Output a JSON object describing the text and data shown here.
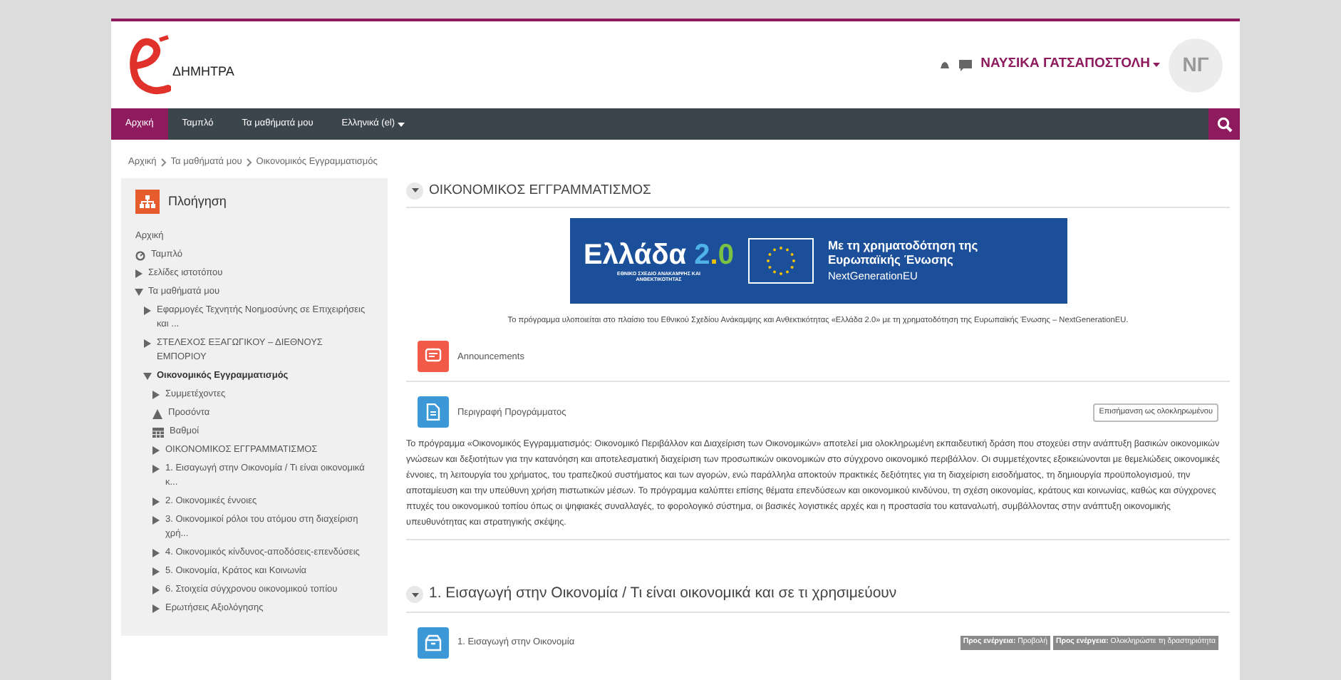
{
  "header": {
    "logo_text": "ΔΗΜΗΤΡΑ",
    "user_name": "ΝΑΥΣΙΚΑ ΓΑΤΣΑΠΟΣΤΟΛΗ",
    "avatar_initials": "ΝΓ"
  },
  "nav": [
    {
      "label": "Αρχική",
      "selected": true,
      "dropdown": false
    },
    {
      "label": "Ταμπλό",
      "selected": false,
      "dropdown": false
    },
    {
      "label": "Τα μαθήματά μου",
      "selected": false,
      "dropdown": false
    },
    {
      "label": "Ελληνικά (el)",
      "selected": false,
      "dropdown": true
    }
  ],
  "breadcrumb": [
    "Αρχική",
    "Τα μαθήματά μου",
    "Οικονομικός Εγγραμματισμός"
  ],
  "sidebar": {
    "title": "Πλοήγηση",
    "items": [
      {
        "label": "Αρχική",
        "kind": "plain",
        "active": false
      },
      {
        "label": "Ταμπλό",
        "kind": "dashboard",
        "active": false
      },
      {
        "label": "Σελίδες ιστοτόπου",
        "kind": "branch",
        "expanded": false,
        "active": false
      },
      {
        "label": "Τα μαθήματά μου",
        "kind": "branch",
        "expanded": true,
        "active": false,
        "children": [
          {
            "label": "Εφαρμογές Τεχνητής Νοημοσύνης σε Επιχειρήσεις και ...",
            "kind": "branch",
            "expanded": false,
            "active": false
          },
          {
            "label": "ΣΤΕΛΕΧΟΣ ΕΞΑΓΩΓΙΚΟΥ – ΔΙΕΘΝΟΥΣ ΕΜΠΟΡΙΟΥ",
            "kind": "branch",
            "expanded": false,
            "active": false
          },
          {
            "label": "Οικονομικός Εγγραμματισμός",
            "kind": "branch",
            "expanded": true,
            "active": true,
            "children": [
              {
                "label": "Συμμετέχοντες",
                "kind": "branch",
                "expanded": false,
                "active": false
              },
              {
                "label": "Προσόντα",
                "kind": "badge",
                "active": false
              },
              {
                "label": "Βαθμοί",
                "kind": "grades",
                "active": false
              },
              {
                "label": "ΟΙΚΟΝΟΜΙΚΟΣ ΕΓΓΡΑΜΜΑΤΙΣΜΟΣ",
                "kind": "branch",
                "expanded": false,
                "active": false
              },
              {
                "label": "1. Εισαγωγή στην Οικονομία / Τι είναι οικονομικά κ...",
                "kind": "branch",
                "expanded": false,
                "active": false
              },
              {
                "label": "2. Οικονομικές έννοιες",
                "kind": "branch",
                "expanded": false,
                "active": false
              },
              {
                "label": "3. Οικονομικοί ρόλοι του ατόμου στη διαχείριση χρή...",
                "kind": "branch",
                "expanded": false,
                "active": false
              },
              {
                "label": "4. Οικονομικός κίνδυνος-αποδόσεις-επενδύσεις",
                "kind": "branch",
                "expanded": false,
                "active": false
              },
              {
                "label": "5. Οικονομία, Κράτος και Κοινωνία",
                "kind": "branch",
                "expanded": false,
                "active": false
              },
              {
                "label": "6. Στοιχεία σύγχρονου οικονομικού τοπίου",
                "kind": "branch",
                "expanded": false,
                "active": false
              },
              {
                "label": "Ερωτήσεις Αξιολόγησης",
                "kind": "branch",
                "expanded": false,
                "active": false
              }
            ]
          }
        ]
      }
    ]
  },
  "sections": [
    {
      "title": "ΟΙΚΟΝΟΜΙΚΟΣ ΕΓΓΡΑΜΜΑΤΙΣΜΟΣ",
      "expanded": true,
      "banner": {
        "title": "Ελλάδα",
        "version": "2.0",
        "subtitle": "ΕΘΝΙΚΟ ΣΧΕΔΙΟ ΑΝΑΚΑΜΨΗΣ ΚΑΙ ΑΝΘΕΚΤΙΚΟΤΗΤΑΣ",
        "funding": "Με τη χρηματοδότηση της Ευρωπαϊκής Ένωσης",
        "program": "NextGenerationEU"
      },
      "caption": "Το πρόγραμμα υλοποιείται στο πλαίσιο του Εθνικού Σχεδίου Ανάκαμψης και Ανθεκτικότητας «Ελλάδα 2.0» με τη χρηματοδότηση της Ευρωπαϊκής Ένωσης – NextGenerationEU.",
      "activities": [
        {
          "kind": "forum",
          "name": "Announcements"
        },
        {
          "kind": "page",
          "name": "Περιγραφή Προγράμματος",
          "button": "Επισήμανση ως ολοκληρωμένου",
          "description": "Το πρόγραμμα «Οικονομικός Εγγραμματισμός: Οικονομικό Περιβάλλον και Διαχείριση των Οικονομικών» αποτελεί μια ολοκληρωμένη εκπαιδευτική δράση που στοχεύει στην ανάπτυξη βασικών οικονομικών γνώσεων και δεξιοτήτων για την κατανόηση και αποτελεσματική διαχείριση των προσωπικών οικονομικών στο σύγχρονο οικονομικό περιβάλλον. Οι συμμετέχοντες εξοικειώνονται με θεμελιώδεις οικονομικές έννοιες, τη λειτουργία του χρήματος, του τραπεζικού συστήματος και των αγορών, ενώ παράλληλα αποκτούν πρακτικές δεξιότητες για τη διαχείριση εισοδήματος, τη δημιουργία προϋπολογισμού, την αποταμίευση και την υπεύθυνη χρήση πιστωτικών μέσων. Το πρόγραμμα καλύπτει επίσης θέματα επενδύσεων και οικονομικού κινδύνου, τη σχέση οικονομίας, κράτους και κοινωνίας, καθώς και σύγχρονες πτυχές του οικονομικού τοπίου όπως οι ψηφιακές συναλλαγές, το φορολογικό σύστημα, οι βασικές λογιστικές αρχές και η προστασία του καταναλωτή, συμβάλλοντας στην ανάπτυξη οικονομικής υπευθυνότητας και στρατηγικής σκέψης."
        }
      ]
    },
    {
      "title": "1. Εισαγωγή στην Οικονομία / Τι είναι οικονομικά και σε τι χρησιμεύουν",
      "expanded": true,
      "activities": [
        {
          "kind": "package",
          "name": "1. Εισαγωγή στην Οικονομία",
          "badges": [
            "**Προς ενέργεια:** Προβολή",
            "**Προς ενέργεια:** Ολοκληρώστε τη δραστηριότητα"
          ]
        }
      ]
    }
  ]
}
